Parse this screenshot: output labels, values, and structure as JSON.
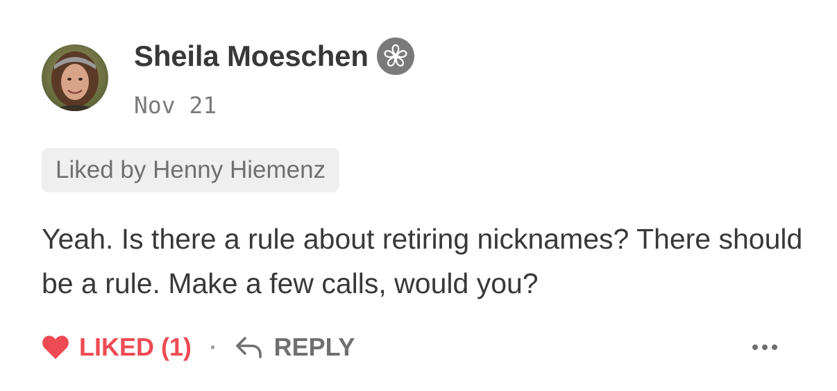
{
  "author": {
    "name": "Sheila Moeschen",
    "badge_icon": "flower-badge-icon",
    "avatar": "profile-photo"
  },
  "comment": {
    "date": "Nov 21",
    "liked_by": "Liked by Henny Hiemenz",
    "text": "Yeah. Is there a rule about retiring nicknames? There should be a rule. Make a few calls, would you?"
  },
  "actions": {
    "like_label": "LIKED (1)",
    "separator": "·",
    "reply_label": "REPLY",
    "more_icon": "ellipsis-icon"
  },
  "colors": {
    "liked": "#ee4a53",
    "text": "#383838",
    "muted": "#6f6f6f"
  }
}
